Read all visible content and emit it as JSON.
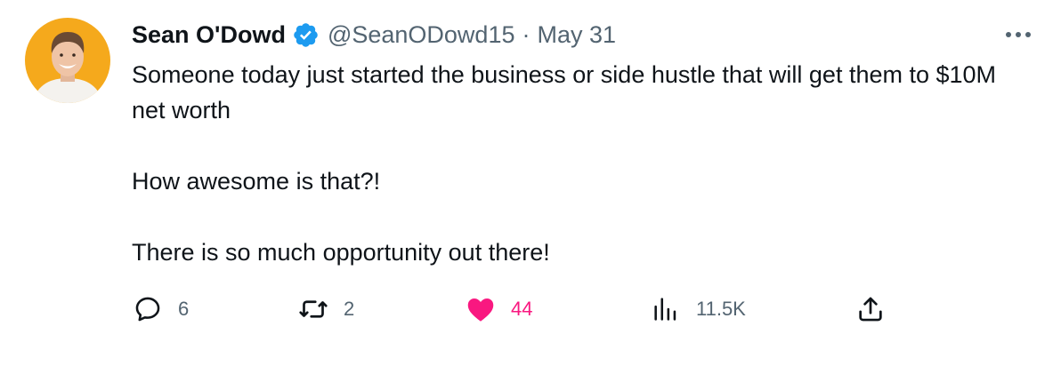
{
  "author": {
    "name": "Sean O'Dowd",
    "handle": "@SeanODowd15",
    "separator": "·",
    "date": "May 31",
    "verified": true,
    "avatar_bg": "#f5a91c"
  },
  "tweet": {
    "paragraphs": [
      "Someone today just started the business or side hustle that will get them to $10M net worth",
      "How awesome is that?!",
      "There is so much opportunity out there!"
    ]
  },
  "actions": {
    "replies": "6",
    "retweets": "2",
    "likes": "44",
    "views": "11.5K"
  },
  "icons": {
    "reply": "reply-icon",
    "retweet": "retweet-icon",
    "like": "heart-icon",
    "views": "views-icon",
    "share": "share-icon",
    "more": "more-icon"
  },
  "colors": {
    "text": "#0f1419",
    "secondary": "#536471",
    "verified": "#1d9bf0",
    "like": "#f91880"
  }
}
